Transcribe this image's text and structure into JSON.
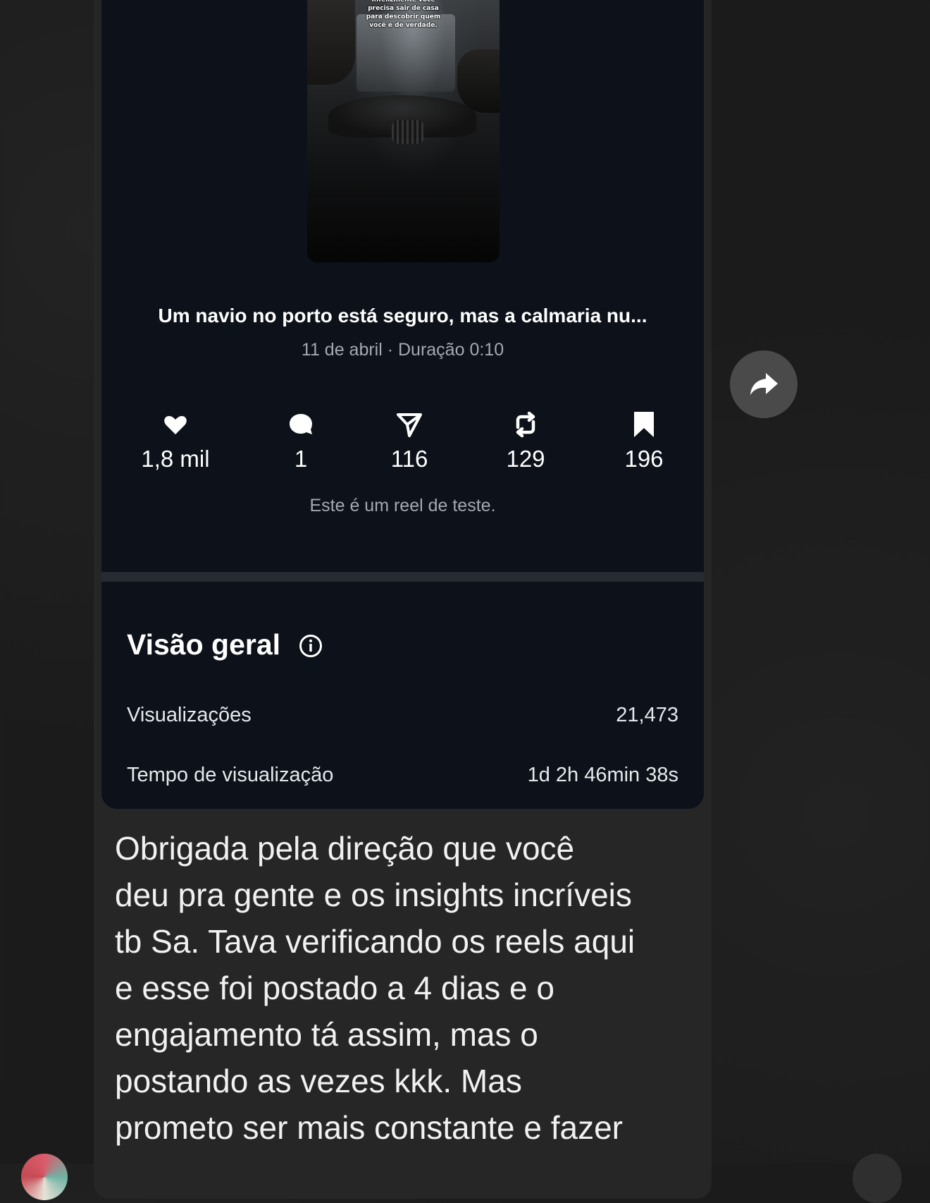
{
  "reel": {
    "thumbnail_overlay_text": "Infelizmente você precisa sair de casa para descobrir quem você é de verdade.",
    "caption": "Um navio no porto está seguro, mas a calmaria nu...",
    "meta": "11 de abril · Duração 0:10",
    "stats": [
      {
        "icon": "heart-icon",
        "value": "1,8 mil"
      },
      {
        "icon": "comment-icon",
        "value": "1"
      },
      {
        "icon": "send-icon",
        "value": "116"
      },
      {
        "icon": "repost-icon",
        "value": "129"
      },
      {
        "icon": "bookmark-icon",
        "value": "196"
      }
    ],
    "note": "Este é um reel de teste."
  },
  "overview": {
    "title": "Visão geral",
    "rows": [
      {
        "label": "Visualizações",
        "value": "21,473"
      },
      {
        "label": "Tempo de visualização",
        "value": "1d 2h 46min 38s"
      }
    ]
  },
  "message": {
    "text": "Obrigada pela direção que você\ndeu pra gente e os insights incríveis\ntb Sa. Tava verificando os reels aqui\ne esse foi postado a 4 dias e o\nengajamento tá assim, mas o\npostando as vezes kkk. Mas\nprometo ser mais constante e fazer"
  },
  "colors": {
    "background": "#1b1b1b",
    "bubble": "#262626",
    "card": "#0c111a",
    "muted_text": "#a5a9b0"
  }
}
